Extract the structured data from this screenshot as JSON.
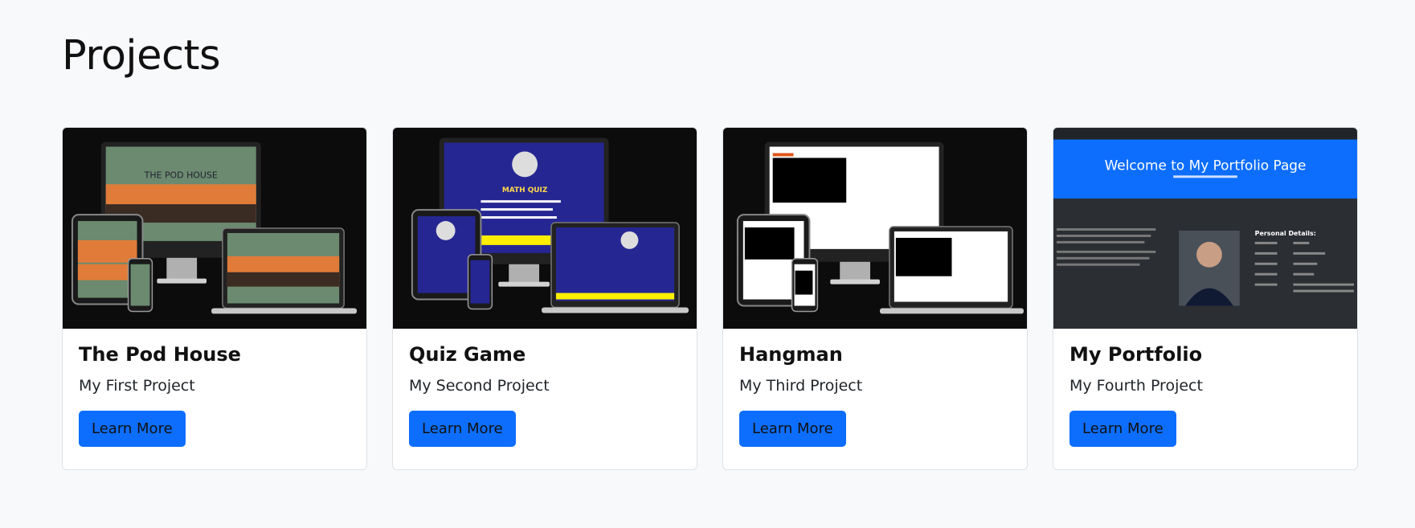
{
  "page": {
    "heading": "Projects",
    "colors": {
      "background": "#f8f9fa",
      "accent": "#0d6efd",
      "thumb_bg": "#0c0c0d"
    }
  },
  "cards": [
    {
      "title": "The Pod House",
      "subtitle": "My First Project",
      "button": "Learn More",
      "screen_text": "THE POD HOUSE"
    },
    {
      "title": "Quiz Game",
      "subtitle": "My Second Project",
      "button": "Learn More",
      "screen_text": "MATH QUIZ"
    },
    {
      "title": "Hangman",
      "subtitle": "My Third Project",
      "button": "Learn More"
    },
    {
      "title": "My Portfolio",
      "subtitle": "My Fourth Project",
      "button": "Learn More",
      "screen_heading": "Welcome to My Portfolio Page",
      "screen_section": "Personal Details:"
    }
  ]
}
